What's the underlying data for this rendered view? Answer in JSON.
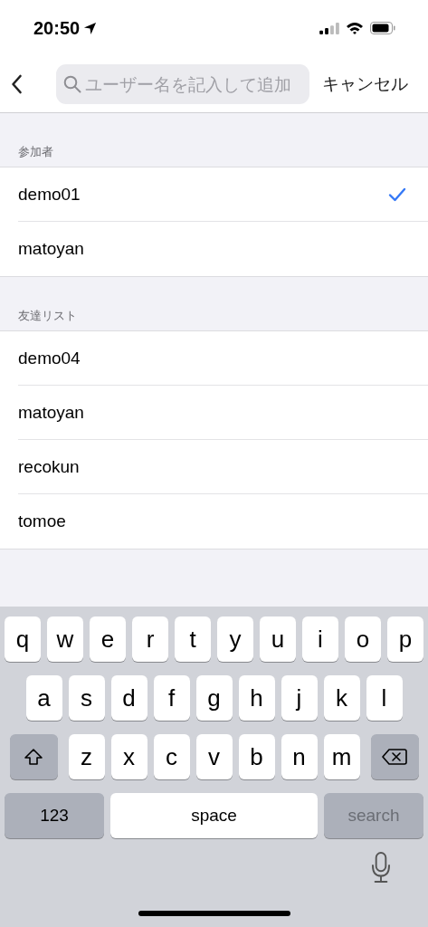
{
  "status_bar": {
    "time": "20:50"
  },
  "nav": {
    "search": {
      "placeholder": "ユーザー名を記入して追加"
    },
    "cancel": "キャンセル"
  },
  "sections": [
    {
      "header": "参加者",
      "items": [
        {
          "label": "demo01",
          "checked": true
        },
        {
          "label": "matoyan",
          "checked": false
        }
      ]
    },
    {
      "header": "友達リスト",
      "items": [
        {
          "label": "demo04",
          "checked": false
        },
        {
          "label": "matoyan",
          "checked": false
        },
        {
          "label": "recokun",
          "checked": false
        },
        {
          "label": "tomoe",
          "checked": false
        }
      ]
    }
  ],
  "keyboard": {
    "letter_rows": [
      {
        "keys": [
          {
            "kind": "letter",
            "label": "q"
          },
          {
            "kind": "letter",
            "label": "w"
          },
          {
            "kind": "letter",
            "label": "e"
          },
          {
            "kind": "letter",
            "label": "r"
          },
          {
            "kind": "letter",
            "label": "t"
          },
          {
            "kind": "letter",
            "label": "y"
          },
          {
            "kind": "letter",
            "label": "u"
          },
          {
            "kind": "letter",
            "label": "i"
          },
          {
            "kind": "letter",
            "label": "o"
          },
          {
            "kind": "letter",
            "label": "p"
          }
        ]
      },
      {
        "keys": [
          {
            "kind": "letter",
            "label": "a"
          },
          {
            "kind": "letter",
            "label": "s"
          },
          {
            "kind": "letter",
            "label": "d"
          },
          {
            "kind": "letter",
            "label": "f"
          },
          {
            "kind": "letter",
            "label": "g"
          },
          {
            "kind": "letter",
            "label": "h"
          },
          {
            "kind": "letter",
            "label": "j"
          },
          {
            "kind": "letter",
            "label": "k"
          },
          {
            "kind": "letter",
            "label": "l"
          }
        ]
      },
      {
        "keys": [
          {
            "kind": "shift"
          },
          {
            "kind": "letter",
            "label": "z"
          },
          {
            "kind": "letter",
            "label": "x"
          },
          {
            "kind": "letter",
            "label": "c"
          },
          {
            "kind": "letter",
            "label": "v"
          },
          {
            "kind": "letter",
            "label": "b"
          },
          {
            "kind": "letter",
            "label": "n"
          },
          {
            "kind": "letter",
            "label": "m"
          },
          {
            "kind": "delete"
          }
        ]
      }
    ],
    "numbers_key": "123",
    "space_key": "space",
    "action_key": {
      "label": "search",
      "disabled": true
    }
  }
}
